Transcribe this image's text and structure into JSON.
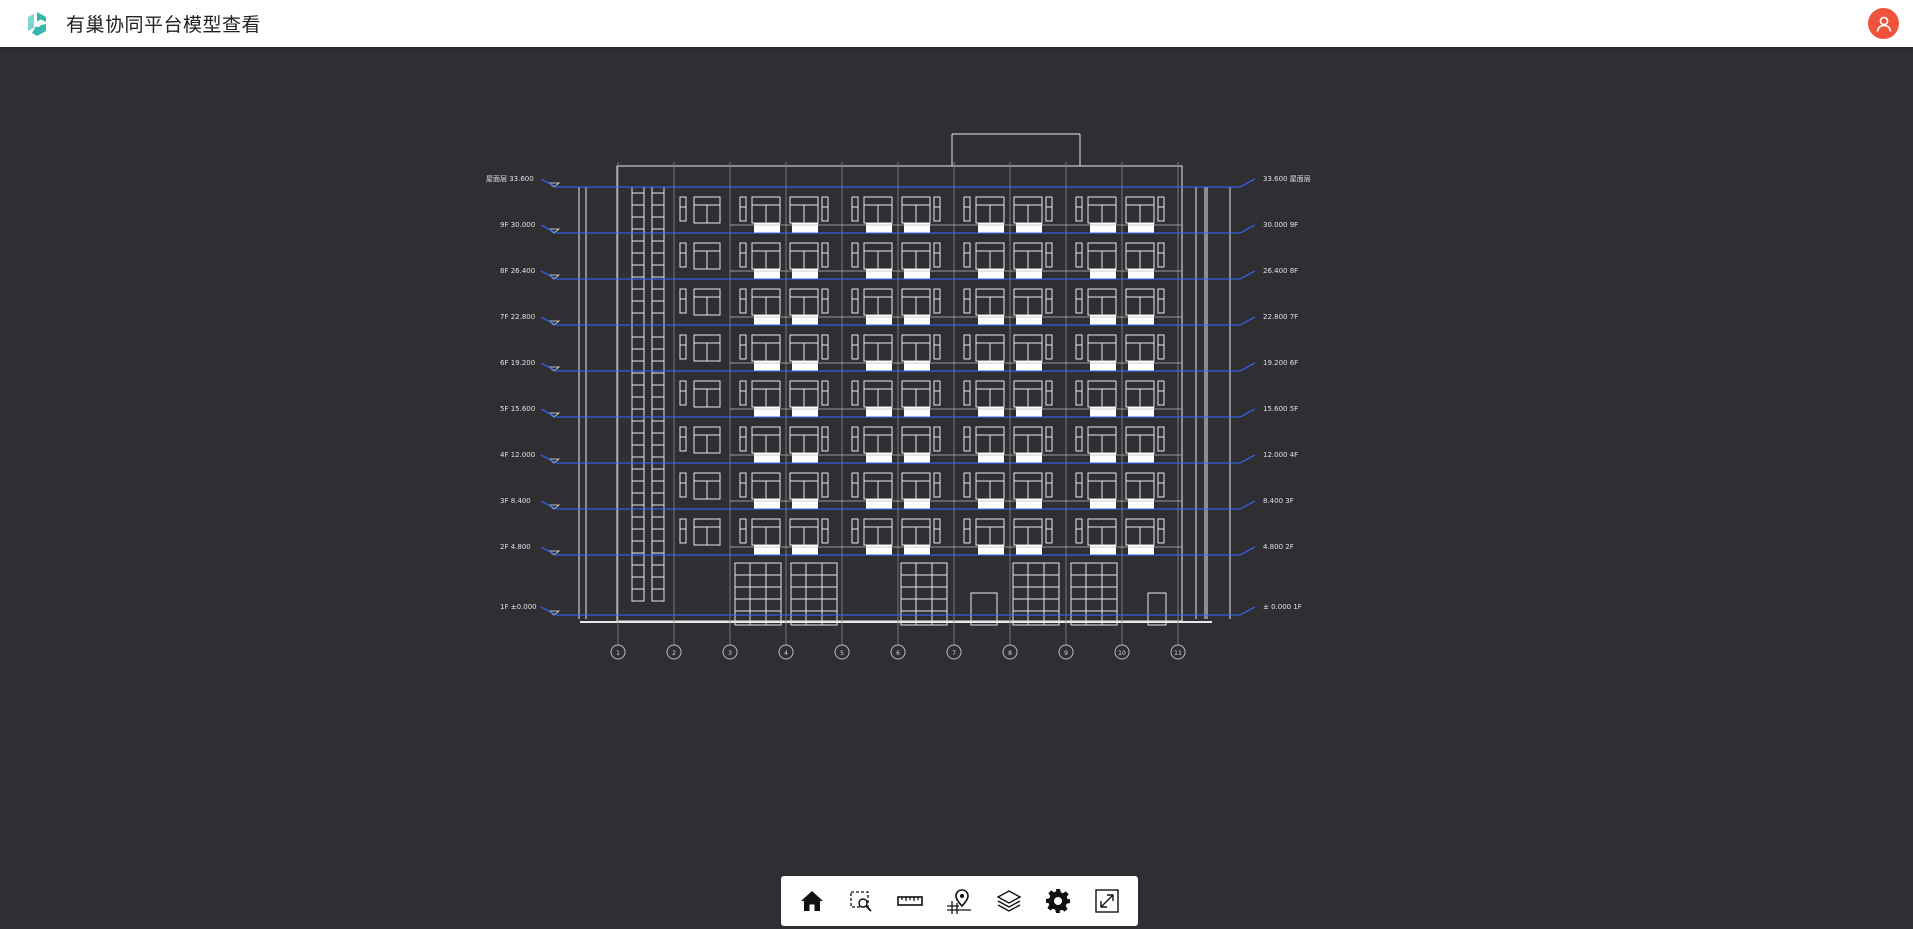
{
  "app": {
    "title": "有巢协同平台模型查看"
  },
  "colors": {
    "header_bg": "#ffffff",
    "viewer_bg": "#2f2f33",
    "accent": "#3bb5b0",
    "avatar": "#f0533c",
    "level_line": "#2f6bff"
  },
  "levels_left": [
    "屋面层 33.600",
    "9F 30.000",
    "8F 26.400",
    "7F 22.800",
    "6F 19.200",
    "5F 15.600",
    "4F 12.000",
    "3F 8.400",
    "2F 4.800",
    "1F ±0.000"
  ],
  "levels_right": [
    "33.600 屋面层",
    "30.000 9F",
    "26.400 8F",
    "22.800 7F",
    "19.200 6F",
    "15.600 5F",
    "12.000 4F",
    "8.400 3F",
    "4.800 2F",
    "± 0.000 1F"
  ],
  "grid_axes": [
    "1",
    "2",
    "3",
    "4",
    "5",
    "6",
    "7",
    "8",
    "9",
    "10",
    "11"
  ],
  "toolbar": {
    "items": [
      {
        "name": "home",
        "icon": "home-icon"
      },
      {
        "name": "zoom-window",
        "icon": "zoom-window-icon"
      },
      {
        "name": "measure",
        "icon": "ruler-icon"
      },
      {
        "name": "locate",
        "icon": "location-pin-icon"
      },
      {
        "name": "layers",
        "icon": "layers-icon"
      },
      {
        "name": "settings",
        "icon": "gear-icon"
      },
      {
        "name": "fullscreen",
        "icon": "fullscreen-icon"
      }
    ]
  }
}
